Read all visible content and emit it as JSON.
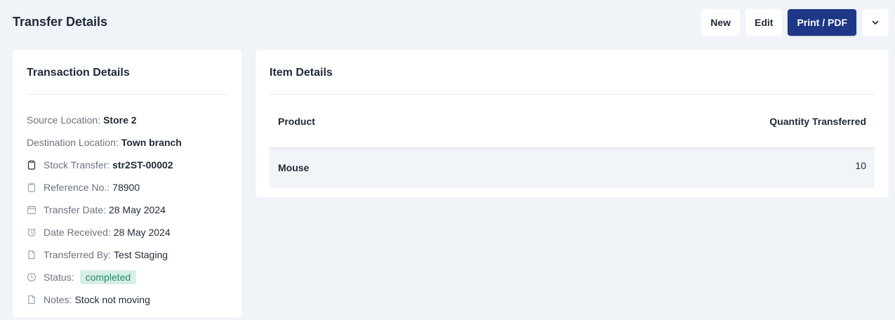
{
  "header": {
    "title": "Transfer Details",
    "buttons": {
      "new_label": "New",
      "edit_label": "Edit",
      "print_label": "Print / PDF"
    }
  },
  "transaction": {
    "title": "Transaction Details",
    "rows": [
      {
        "icon": "none",
        "label": "Source Location:",
        "value": "Store 2"
      },
      {
        "icon": "none",
        "label": "Destination Location:",
        "value": "Town branch"
      },
      {
        "icon": "clipboard-icon",
        "label": "Stock Transfer:",
        "value": "str2ST-00002"
      },
      {
        "icon": "clipboard-icon",
        "label": "Reference No.:",
        "value": "78900"
      },
      {
        "icon": "calendar-icon",
        "label": "Transfer Date:",
        "value": "28 May 2024"
      },
      {
        "icon": "alarm-clock-icon",
        "label": "Date Received:",
        "value": "28 May 2024"
      },
      {
        "icon": "file-icon",
        "label": "Transferred By:",
        "value": "Test Staging"
      },
      {
        "icon": "clock-icon",
        "label": "Status:",
        "value": "completed"
      },
      {
        "icon": "file-icon",
        "label": "Notes:",
        "value": "Stock not moving"
      }
    ]
  },
  "items": {
    "title": "Item Details",
    "columns": [
      "Product",
      "Quantity Transferred"
    ],
    "rows": [
      {
        "product": "Mouse",
        "quantity": "10"
      }
    ]
  },
  "colors": {
    "primary": "#1e3786",
    "status_bg": "#d5efe6",
    "status_text": "#2a8a64",
    "page_bg": "#f0f3f8"
  }
}
